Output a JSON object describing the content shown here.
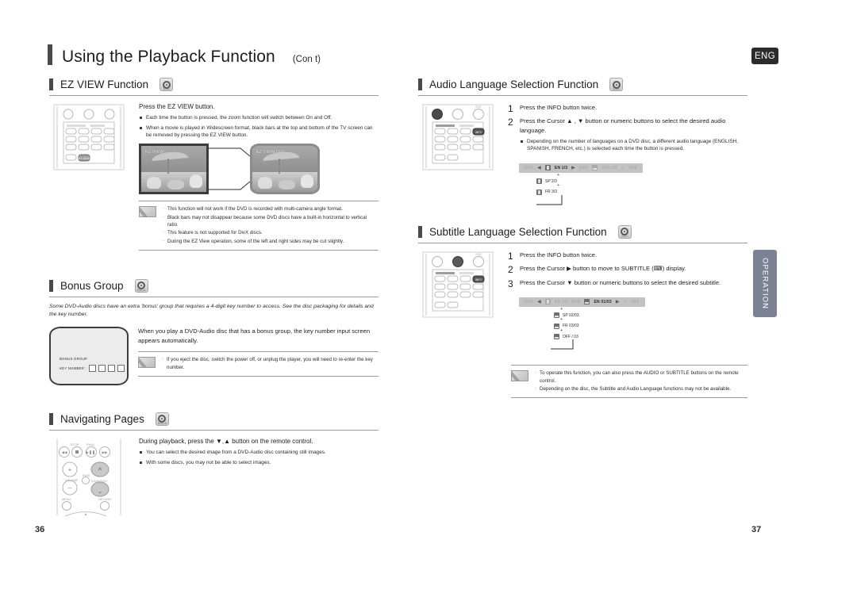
{
  "header": {
    "title": "Using the Playback Function",
    "cont": "(Con t)",
    "lang_badge": "ENG"
  },
  "side_tab": {
    "label": "OPERATION"
  },
  "pages": {
    "left_number": "36",
    "right_number": "37"
  },
  "left_column": {
    "ez_view": {
      "heading": "EZ VIEW Function",
      "disc_icon": "dvd-disc-icon",
      "disc_icon_label": "DVD",
      "lead": "Press the EZ VIEW button.",
      "bullets": [
        "Each time the button is pressed, the zoom function will switch between On and Off.",
        "When a movie is played in Widescreen format, black bars at the top and bottom of the TV screen can be removed by pressing the EZ VIEW button."
      ],
      "screens": [
        {
          "osd": "EZ VIEW",
          "style": "flat"
        },
        {
          "osd": "EZ VIEW OFF",
          "style": "round"
        }
      ],
      "notes": [
        "This function will not work if the DVD is recorded with multi-camera angle format.",
        "Black bars may not disappear because some DVD discs have a built-in horizontal to vertical ratio.",
        "This feature is not supported for DivX discs.",
        "During the EZ View operation, some of the left and right sides may be cut slightly."
      ],
      "remote_highlight": "EZ VIEW"
    },
    "bonus_group": {
      "heading": "Bonus Group",
      "disc_icon": "dvd-audio-disc-icon",
      "disc_icon_label": "DVD-A",
      "intro": "Some DVD-Audio discs have an extra 'bonus' group that requires a 4-digit key number to access. See the disc packaging for details and the key number.",
      "screen": {
        "title": "BONUS GROUP",
        "key_label": "KEY NUMBER :",
        "boxes": [
          "-",
          "-",
          "-",
          "-"
        ]
      },
      "body": "When you play a DVD-Audio disc that has a bonus group, the key number input screen appears automatically.",
      "notes": [
        "If you eject the disc, switch the power off, or unplug the player, you will need to re-enter the key number."
      ]
    },
    "navigating_pages": {
      "heading": "Navigating Pages",
      "disc_icon": "dvd-audio-disc-icon",
      "disc_icon_label": "DVD-A",
      "lead": "During playback, press the  ▼,▲ button on the remote control.",
      "bullets": [
        "You can select the desired image from a DVD-Audio disc containing still images.",
        "With some discs, you may not be able to select images."
      ],
      "remote_labels": {
        "stop": "STOP",
        "play": "PLAY",
        "volume": "VOLUME",
        "mute": "MUTE",
        "tuning": "TUNING/CH",
        "menu": "MENU",
        "return": "RETURN",
        "plus": "+",
        "minus": "–"
      }
    }
  },
  "right_column": {
    "audio_language": {
      "heading": "Audio Language Selection Function",
      "disc_icon": "dvd-disc-icon",
      "disc_icon_label": "DVD",
      "steps": [
        {
          "num": "1",
          "text": "Press the INFO button twice."
        },
        {
          "num": "2",
          "text": "Press the Cursor ▲ , ▼ button or numeric buttons to select the desired audio language."
        }
      ],
      "bullets": [
        "Depending on the number of languages on a DVD disc, a different audio language (ENGLISH, SPANISH, FRENCH, etc.) is selected each time the button is pressed."
      ],
      "osd": {
        "prefix": "DVD",
        "left_arrow": "◀",
        "active": "EN 1/3",
        "right_arrow": "▶",
        "dim_middle": "DVD",
        "dim_subtitle": "OFF/ 02",
        "dim_angle": "OFF"
      },
      "cascade": [
        {
          "text": "EN 1/3"
        },
        {
          "text": "SP 2/3"
        },
        {
          "text": "FR 3/3"
        }
      ],
      "remote_highlight": "INFO"
    },
    "subtitle_language": {
      "heading": "Subtitle Language Selection Function",
      "disc_icon": "dvd-disc-icon",
      "disc_icon_label": "DVD",
      "steps": [
        {
          "num": "1",
          "text": "Press the INFO button twice."
        },
        {
          "num": "2",
          "text": "Press the Cursor ▶ button to move to SUBTITLE (⌨) display."
        },
        {
          "num": "3",
          "text": "Press the Cursor ▼ button or numeric buttons to select the desired subtitle."
        }
      ],
      "osd": {
        "prefix": "DVD",
        "left_arrow": "◀",
        "dim_audio": "EN 1/3",
        "dim_mid": "DVD",
        "active": "EN 01/03",
        "right_arrow": "▶",
        "dim_angle": "OFF"
      },
      "cascade": [
        {
          "text": "EN 01/03"
        },
        {
          "text": "SP 02/03"
        },
        {
          "text": "FR 03/03"
        },
        {
          "text": "OFF / 03"
        }
      ],
      "remote_highlight": "INFO",
      "notes": [
        "To operate this function, you can also press the AUDIO or SUBTITLE buttons on the remote control.",
        "Depending on the disc, the Subtitle and Audio Language functions may not be available."
      ]
    }
  }
}
